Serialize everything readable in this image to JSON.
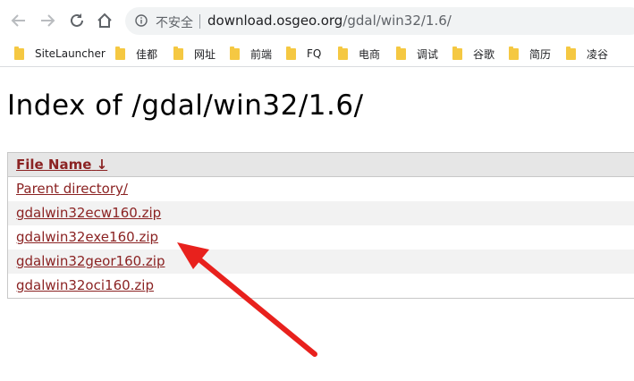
{
  "browser": {
    "security_label": "不安全",
    "url_host": "download.osgeo.org",
    "url_path": "/gdal/win32/1.6/",
    "icons": {
      "back": "back-arrow-icon",
      "forward": "forward-arrow-icon",
      "reload": "reload-icon",
      "home": "home-icon",
      "info": "info-icon"
    }
  },
  "bookmarks": [
    {
      "label": "SiteLauncher"
    },
    {
      "label": "佳都"
    },
    {
      "label": "网址"
    },
    {
      "label": "前端"
    },
    {
      "label": "FQ"
    },
    {
      "label": "电商"
    },
    {
      "label": "调试"
    },
    {
      "label": "谷歌"
    },
    {
      "label": "简历"
    },
    {
      "label": "凌谷"
    }
  ],
  "page": {
    "title": "Index of /gdal/win32/1.6/"
  },
  "listing": {
    "header_label": "File Name",
    "header_sort_indicator": "↓",
    "rows": [
      {
        "name": "Parent directory/"
      },
      {
        "name": "gdalwin32ecw160.zip"
      },
      {
        "name": "gdalwin32exe160.zip"
      },
      {
        "name": "gdalwin32geor160.zip"
      },
      {
        "name": "gdalwin32oci160.zip"
      }
    ]
  },
  "annotation": {
    "arrow_color": "#e8211d",
    "points_to": "gdalwin32exe160.zip"
  },
  "colors": {
    "link": "#8b2323",
    "header_bg": "#e6e6e6",
    "alt_row_bg": "#f2f2f2",
    "folder": "#f5c842"
  }
}
